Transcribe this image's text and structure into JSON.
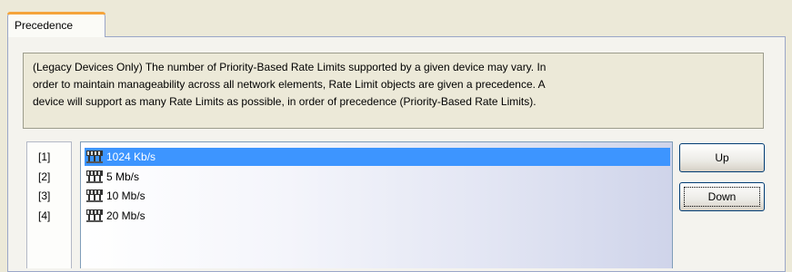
{
  "tab": {
    "label": "Precedence"
  },
  "description": {
    "lines": [
      "(Legacy Devices Only) The number of Priority-Based Rate Limits supported by a given device may vary. In",
      "order to maintain manageability across all network elements, Rate Limit objects are given a precedence.  A",
      "device will support as many Rate Limits as possible, in order of precedence (Priority-Based Rate Limits)."
    ]
  },
  "precedence_indices": [
    "[1]",
    "[2]",
    "[3]",
    "[4]"
  ],
  "rate_limits": [
    {
      "label": "1024 Kb/s",
      "icon": "rate-limit-icon",
      "selected": true
    },
    {
      "label": "5 Mb/s",
      "icon": "rate-limit-icon",
      "selected": false
    },
    {
      "label": "10 Mb/s",
      "icon": "rate-limit-icon",
      "selected": false
    },
    {
      "label": "20 Mb/s",
      "icon": "rate-limit-icon",
      "selected": false
    }
  ],
  "buttons": {
    "up": "Up",
    "down": "Down"
  },
  "colors": {
    "selection": "#3d95ff",
    "tab_accent": "#f5a43b",
    "border": "#9aa6c8"
  }
}
